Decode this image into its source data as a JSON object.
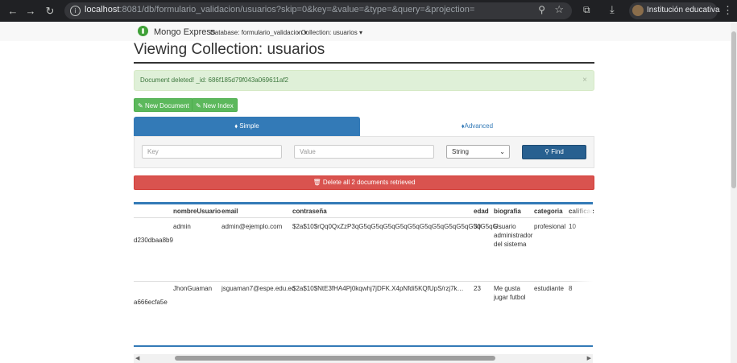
{
  "browser": {
    "url_host": "localhost",
    "url_rest": ":8081/db/formulario_validacion/usuarios?skip=0&key=&value=&type=&query=&projection=",
    "profile_name": "Institución educativa"
  },
  "navbar": {
    "brand": "Mongo Express",
    "database_label": "Database: formulario_validacion",
    "collection_label": "Collection: usuarios"
  },
  "page": {
    "title": "Viewing Collection: usuarios",
    "alert": "Document deleted! _id: 686f185d79f043a069611af2",
    "alert_close": "×",
    "new_document": "New Document",
    "new_index": "New Index"
  },
  "query": {
    "tab_simple": "Simple",
    "tab_advanced": "Advanced",
    "key_placeholder": "Key",
    "value_placeholder": "Value",
    "type_selected": "String",
    "find_label": "Find",
    "delete_all": "Delete all 2 documents retrieved"
  },
  "table": {
    "headers": [
      "nombreUsuario",
      "email",
      "contraseña",
      "edad",
      "biografia",
      "categoria",
      "calificac"
    ],
    "rows": [
      {
        "id": "d230dbaa8b9",
        "nombreUsuario": "admin",
        "email": "admin@ejemplo.com",
        "password": "$2a$10$rQq0QxZzP3qG5qG5qG5qG5qG5qG5qG5qG5qG5qG5qG5qG…",
        "edad": "30",
        "bio1": "Usuario",
        "bio2": "administrador",
        "bio3": "del sistema",
        "categoria": "profesional",
        "calificacion": "10"
      },
      {
        "id": "a666ecfa5e",
        "nombreUsuario": "JhonGuaman",
        "email": "jsguaman7@espe.edu.ec",
        "password": "$2a$10$NtE3fHA4Pj0kqwhj7jDFK.X4pNfdi5KQfUpS/rzj7k…",
        "edad": "23",
        "bio1": "Me gusta",
        "bio2": "jugar futbol",
        "bio3": "",
        "categoria": "estudiante",
        "calificacion": "8"
      }
    ]
  },
  "icons": {
    "back": "back-arrow-icon",
    "forward": "forward-arrow-icon",
    "reload": "reload-icon",
    "info": "site-info-icon",
    "pencil": "pencil-icon",
    "tag": "tag-icon",
    "tags": "tags-icon",
    "search": "search-icon",
    "trash": "trash-icon"
  },
  "colors": {
    "primary": "#337ab7",
    "success": "#5cb85c",
    "danger": "#d9534f",
    "alert_bg": "#dff0d8",
    "alert_text": "#3c763d"
  }
}
